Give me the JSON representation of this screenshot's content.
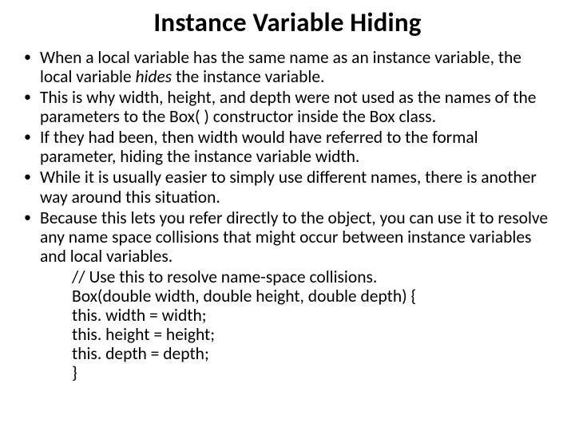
{
  "title": "Instance Variable Hiding",
  "bullets": [
    {
      "pre": "When a local variable has the same name as an instance variable, the local variable ",
      "em": "hides",
      "post": " the instance variable."
    },
    {
      "text": "This is why width, height, and depth were not used as the names of the parameters to the Box( ) constructor inside the Box class."
    },
    {
      "text": "If they had been, then width would have referred to the formal parameter, hiding the instance variable width."
    },
    {
      "text": "While it is usually easier to simply use different names, there is another way around this situation."
    },
    {
      "text": "Because this lets you refer directly to the object, you can use it to resolve any name space collisions that might occur between instance variables and local variables."
    }
  ],
  "code": [
    "// Use this to resolve name-space collisions.",
    "Box(double width, double height, double depth) {",
    "this. width = width;",
    "this. height = height;",
    "this. depth = depth;",
    "}"
  ]
}
